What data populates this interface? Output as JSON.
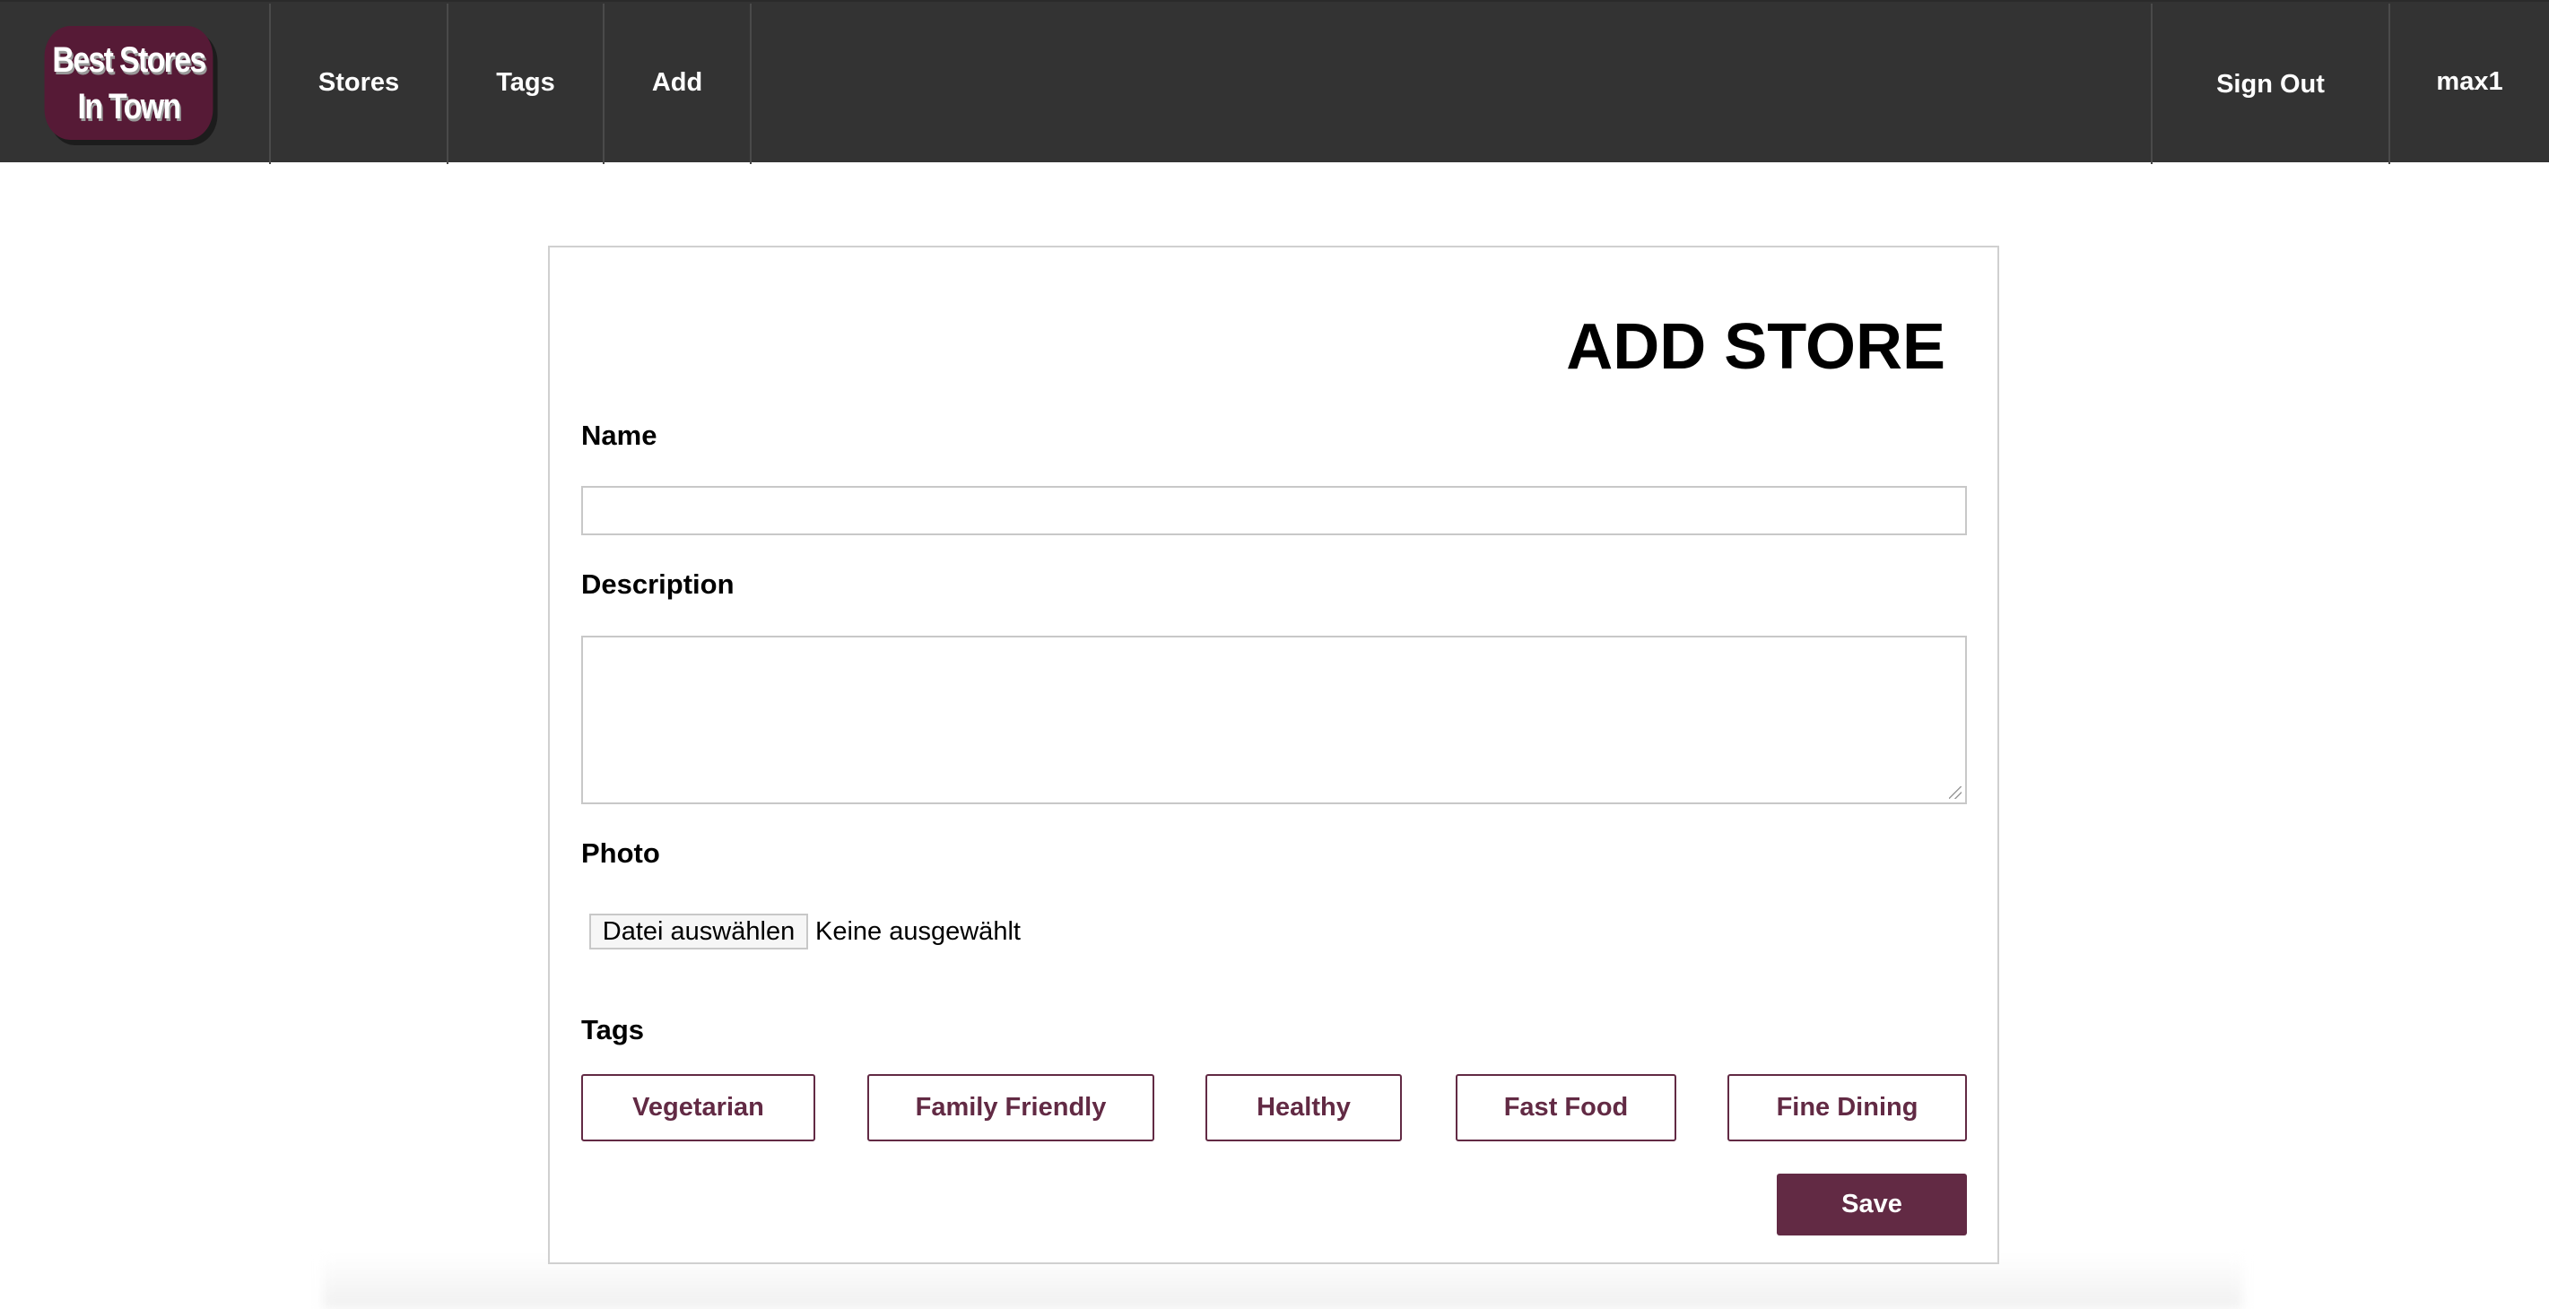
{
  "header": {
    "logo_line1": "Best Stores",
    "logo_line2": "In Town",
    "nav": [
      "Stores",
      "Tags",
      "Add"
    ],
    "sign_out": "Sign Out",
    "user": "max1"
  },
  "form": {
    "title": "ADD STORE",
    "name_label": "Name",
    "name_value": "",
    "description_label": "Description",
    "description_value": "",
    "photo_label": "Photo",
    "file_button": "Datei auswählen",
    "file_status": "Keine ausgewählt",
    "tags_label": "Tags",
    "tags": [
      "Vegetarian",
      "Family Friendly",
      "Healthy",
      "Fast Food",
      "Fine Dining"
    ],
    "save": "Save"
  },
  "colors": {
    "header_bg": "#333333",
    "accent": "#622a44"
  }
}
